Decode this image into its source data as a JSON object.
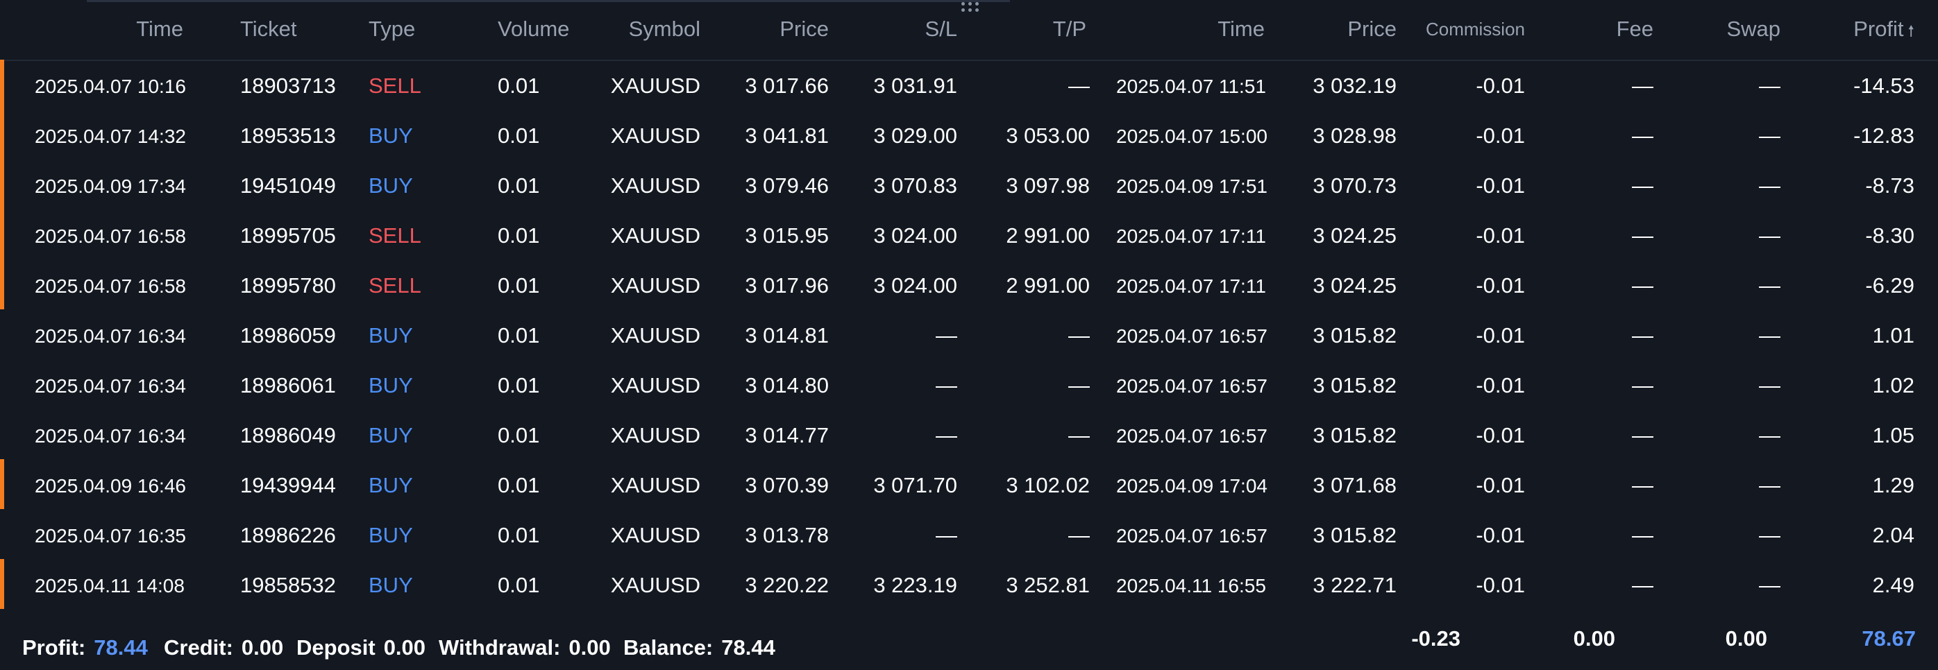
{
  "colors": {
    "background": "#131821",
    "sell": "#f0555a",
    "buy": "#4d8ff5",
    "accent_bar": "#f47d1f",
    "profit_highlight": "#5b94f7"
  },
  "columns": {
    "open_time": "Time",
    "ticket": "Ticket",
    "type": "Type",
    "volume": "Volume",
    "symbol": "Symbol",
    "open_price": "Price",
    "sl": "S/L",
    "tp": "T/P",
    "close_time": "Time",
    "close_price": "Price",
    "commission": "Commission",
    "fee": "Fee",
    "swap": "Swap",
    "profit": "Profit",
    "profit_sort_icon": "sort-ascending-icon"
  },
  "rows": [
    {
      "accent": true,
      "open_time": "2025.04.07 10:16",
      "ticket": "18903713",
      "type": "SELL",
      "volume": "0.01",
      "symbol": "XAUUSD",
      "open_price": "3 017.66",
      "sl": "3 031.91",
      "tp": "—",
      "close_time": "2025.04.07 11:51",
      "close_price": "3 032.19",
      "commission": "-0.01",
      "fee": "—",
      "swap": "—",
      "profit": "-14.53"
    },
    {
      "accent": true,
      "open_time": "2025.04.07 14:32",
      "ticket": "18953513",
      "type": "BUY",
      "volume": "0.01",
      "symbol": "XAUUSD",
      "open_price": "3 041.81",
      "sl": "3 029.00",
      "tp": "3 053.00",
      "close_time": "2025.04.07 15:00",
      "close_price": "3 028.98",
      "commission": "-0.01",
      "fee": "—",
      "swap": "—",
      "profit": "-12.83"
    },
    {
      "accent": true,
      "open_time": "2025.04.09 17:34",
      "ticket": "19451049",
      "type": "BUY",
      "volume": "0.01",
      "symbol": "XAUUSD",
      "open_price": "3 079.46",
      "sl": "3 070.83",
      "tp": "3 097.98",
      "close_time": "2025.04.09 17:51",
      "close_price": "3 070.73",
      "commission": "-0.01",
      "fee": "—",
      "swap": "—",
      "profit": "-8.73"
    },
    {
      "accent": true,
      "open_time": "2025.04.07 16:58",
      "ticket": "18995705",
      "type": "SELL",
      "volume": "0.01",
      "symbol": "XAUUSD",
      "open_price": "3 015.95",
      "sl": "3 024.00",
      "tp": "2 991.00",
      "close_time": "2025.04.07 17:11",
      "close_price": "3 024.25",
      "commission": "-0.01",
      "fee": "—",
      "swap": "—",
      "profit": "-8.30"
    },
    {
      "accent": true,
      "open_time": "2025.04.07 16:58",
      "ticket": "18995780",
      "type": "SELL",
      "volume": "0.01",
      "symbol": "XAUUSD",
      "open_price": "3 017.96",
      "sl": "3 024.00",
      "tp": "2 991.00",
      "close_time": "2025.04.07 17:11",
      "close_price": "3 024.25",
      "commission": "-0.01",
      "fee": "—",
      "swap": "—",
      "profit": "-6.29"
    },
    {
      "accent": false,
      "open_time": "2025.04.07 16:34",
      "ticket": "18986059",
      "type": "BUY",
      "volume": "0.01",
      "symbol": "XAUUSD",
      "open_price": "3 014.81",
      "sl": "—",
      "tp": "—",
      "close_time": "2025.04.07 16:57",
      "close_price": "3 015.82",
      "commission": "-0.01",
      "fee": "—",
      "swap": "—",
      "profit": "1.01"
    },
    {
      "accent": false,
      "open_time": "2025.04.07 16:34",
      "ticket": "18986061",
      "type": "BUY",
      "volume": "0.01",
      "symbol": "XAUUSD",
      "open_price": "3 014.80",
      "sl": "—",
      "tp": "—",
      "close_time": "2025.04.07 16:57",
      "close_price": "3 015.82",
      "commission": "-0.01",
      "fee": "—",
      "swap": "—",
      "profit": "1.02"
    },
    {
      "accent": false,
      "open_time": "2025.04.07 16:34",
      "ticket": "18986049",
      "type": "BUY",
      "volume": "0.01",
      "symbol": "XAUUSD",
      "open_price": "3 014.77",
      "sl": "—",
      "tp": "—",
      "close_time": "2025.04.07 16:57",
      "close_price": "3 015.82",
      "commission": "-0.01",
      "fee": "—",
      "swap": "—",
      "profit": "1.05"
    },
    {
      "accent": true,
      "open_time": "2025.04.09 16:46",
      "ticket": "19439944",
      "type": "BUY",
      "volume": "0.01",
      "symbol": "XAUUSD",
      "open_price": "3 070.39",
      "sl": "3 071.70",
      "tp": "3 102.02",
      "close_time": "2025.04.09 17:04",
      "close_price": "3 071.68",
      "commission": "-0.01",
      "fee": "—",
      "swap": "—",
      "profit": "1.29"
    },
    {
      "accent": false,
      "open_time": "2025.04.07 16:35",
      "ticket": "18986226",
      "type": "BUY",
      "volume": "0.01",
      "symbol": "XAUUSD",
      "open_price": "3 013.78",
      "sl": "—",
      "tp": "—",
      "close_time": "2025.04.07 16:57",
      "close_price": "3 015.82",
      "commission": "-0.01",
      "fee": "—",
      "swap": "—",
      "profit": "2.04"
    },
    {
      "accent": true,
      "open_time": "2025.04.11 14:08",
      "ticket": "19858532",
      "type": "BUY",
      "volume": "0.01",
      "symbol": "XAUUSD",
      "open_price": "3 220.22",
      "sl": "3 223.19",
      "tp": "3 252.81",
      "close_time": "2025.04.11 16:55",
      "close_price": "3 222.71",
      "commission": "-0.01",
      "fee": "—",
      "swap": "—",
      "profit": "2.49"
    }
  ],
  "summary": {
    "profit_label": "Profit:",
    "profit_value": "78.44",
    "credit_label": "Credit:",
    "credit_value": "0.00",
    "deposit_label": "Deposit",
    "deposit_value": "0.00",
    "withdrawal_label": "Withdrawal:",
    "withdrawal_value": "0.00",
    "balance_label": "Balance:",
    "balance_value": "78.44"
  },
  "totals": {
    "commission": "-0.23",
    "fee": "0.00",
    "swap": "0.00",
    "profit": "78.67"
  }
}
